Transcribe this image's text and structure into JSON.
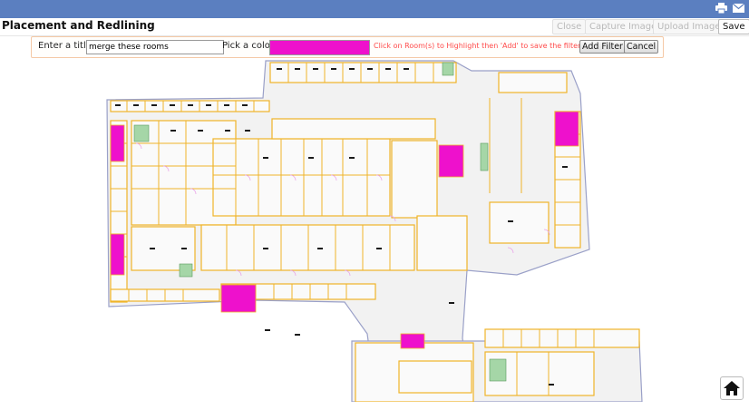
{
  "header": {
    "icons": [
      "print-icon",
      "email-icon"
    ]
  },
  "toolbar": {
    "title": "Placement and Redlining",
    "close_label": "Close",
    "capture_label": "Capture Image",
    "upload_label": "Upload Image",
    "save_label": "Save"
  },
  "filter": {
    "title_label": "Enter a title",
    "title_value": "merge these rooms",
    "color_label": "Pick a color",
    "color_value": "#ee11cc",
    "hint": "Click on Room(s) to Highlight then 'Add' to save the filter.",
    "add_label": "Add Filter",
    "cancel_label": "Cancel"
  },
  "colors": {
    "header_bg": "#5b7fc0",
    "highlight": "#ee11cc",
    "wall": "#f0b429",
    "hint": "#ff4b4b"
  },
  "footer": {
    "home_icon": "home-icon"
  }
}
